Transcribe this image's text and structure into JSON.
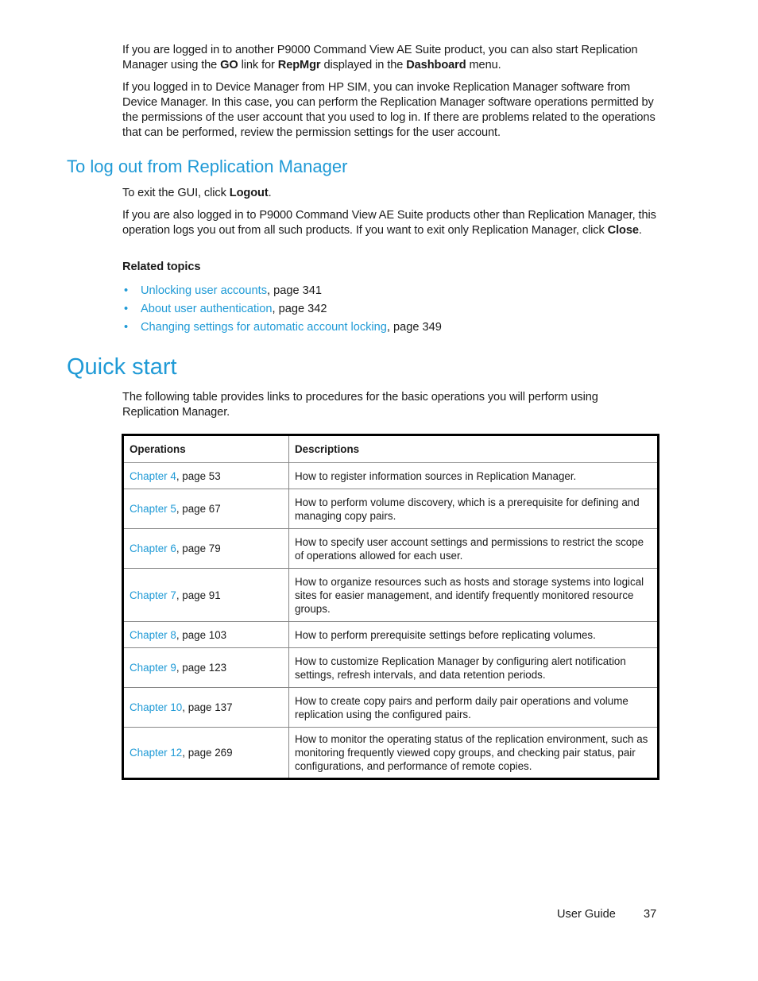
{
  "intro": {
    "p1": {
      "pre": "If you are logged in to another P9000 Command View AE Suite product, you can also start Replication Manager using the ",
      "b1": "GO",
      "mid1": " link for ",
      "b2": "RepMgr",
      "mid2": " displayed in the ",
      "b3": "Dashboard",
      "post": " menu."
    },
    "p2": "If you logged in to Device Manager from HP SIM, you can invoke Replication Manager software from Device Manager. In this case, you can perform the Replication Manager software operations permitted by the permissions of the user account that you used to log in. If there are problems related to the operations that can be performed, review the permission settings for the user account."
  },
  "logout_section": {
    "heading": "To log out from Replication Manager",
    "p1": {
      "pre": "To exit the GUI, click ",
      "bold": "Logout",
      "post": "."
    },
    "p2": {
      "pre": "If you are also logged in to P9000 Command View AE Suite products other than Replication Manager, this operation logs you out from all such products. If you want to exit only Replication Manager, click ",
      "bold": "Close",
      "post": "."
    },
    "related_label": "Related topics",
    "related": [
      {
        "link": "Unlocking user accounts",
        "suffix": ", page 341"
      },
      {
        "link": "About user authentication",
        "suffix": ", page 342"
      },
      {
        "link": "Changing settings for automatic account locking",
        "suffix": ", page 349"
      }
    ]
  },
  "quick_start": {
    "heading": "Quick start",
    "intro": "The following table provides links to procedures for the basic operations you will perform using Replication Manager.",
    "table": {
      "headers": [
        "Operations",
        "Descriptions"
      ],
      "rows": [
        {
          "link": "Chapter 4",
          "page": ", page 53",
          "desc": "How to register information sources in Replication Manager."
        },
        {
          "link": "Chapter 5",
          "page": ", page 67",
          "desc": "How to perform volume discovery, which is a prerequisite for defining and managing copy pairs."
        },
        {
          "link": "Chapter 6",
          "page": ", page 79",
          "desc": "How to specify user account settings and permissions to restrict the scope of operations allowed for each user."
        },
        {
          "link": "Chapter 7",
          "page": ", page 91",
          "desc": "How to organize resources such as hosts and storage systems into logical sites for easier management, and  identify frequently monitored resource groups."
        },
        {
          "link": "Chapter 8",
          "page": ", page 103",
          "desc": "How to perform prerequisite settings before replicating volumes."
        },
        {
          "link": "Chapter 9",
          "page": ", page 123",
          "desc": "How to customize Replication Manager by configuring alert notification settings, refresh intervals, and data retention periods."
        },
        {
          "link": "Chapter 10",
          "page": ", page 137",
          "desc": "How to create copy pairs and perform daily pair operations and volume replication using the configured pairs."
        },
        {
          "link": "Chapter 12",
          "page": ", page 269",
          "desc": "How to monitor the operating status of the replication environment, such as monitoring frequently viewed copy groups, and checking pair status, pair configurations, and performance of remote copies."
        }
      ]
    }
  },
  "footer": {
    "doc_title": "User Guide",
    "page_number": "37"
  },
  "colors": {
    "link": "#1f9ad6",
    "heading": "#1f9ad6",
    "text": "#1a1a1a"
  }
}
